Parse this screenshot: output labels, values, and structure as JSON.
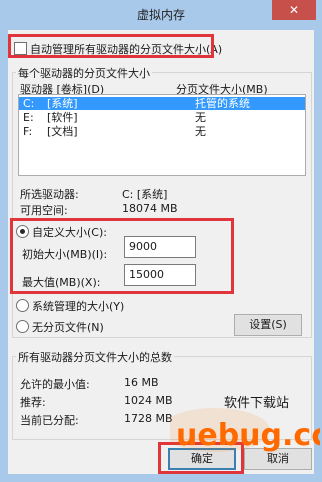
{
  "window": {
    "title": "虚拟内存",
    "close_label": "✕"
  },
  "auto_manage": {
    "label": "自动管理所有驱动器的分页文件大小(A)",
    "checked": false
  },
  "drives_group": {
    "title": "每个驱动器的分页文件大小",
    "col_drive": "驱动器 [卷标](D)",
    "col_size": "分页文件大小(MB)",
    "rows": [
      {
        "drive": "C:",
        "label": "[系统]",
        "size": "托管的系统",
        "selected": true
      },
      {
        "drive": "E:",
        "label": "[软件]",
        "size": "无",
        "selected": false
      },
      {
        "drive": "F:",
        "label": "[文档]",
        "size": "无",
        "selected": false
      }
    ],
    "selected_drive_label": "所选驱动器:",
    "selected_drive_value": "C:  [系统]",
    "available_space_label": "可用空间:",
    "available_space_value": "18074 MB"
  },
  "custom_size": {
    "label": "自定义大小(C):",
    "initial_label": "初始大小(MB)(I):",
    "initial_value": "9000",
    "max_label": "最大值(MB)(X):",
    "max_value": "15000"
  },
  "system_managed": {
    "label": "系统管理的大小(Y)"
  },
  "no_paging": {
    "label": "无分页文件(N)"
  },
  "set_button": "设置(S)",
  "totals_group": {
    "title": "所有驱动器分页文件大小的总数",
    "min_label": "允许的最小值:",
    "min_value": "16 MB",
    "rec_label": "推荐:",
    "rec_value": "1024 MB",
    "cur_label": "当前已分配:",
    "cur_value": "1728 MB"
  },
  "ok_button": "确定",
  "cancel_button": "取消",
  "watermark": {
    "brand": "uebug.cc",
    "caption": "软件下载站"
  },
  "colors": {
    "accent": "#3399ff",
    "highlight": "#e0353a",
    "titlebar": "#a9c9ea"
  }
}
